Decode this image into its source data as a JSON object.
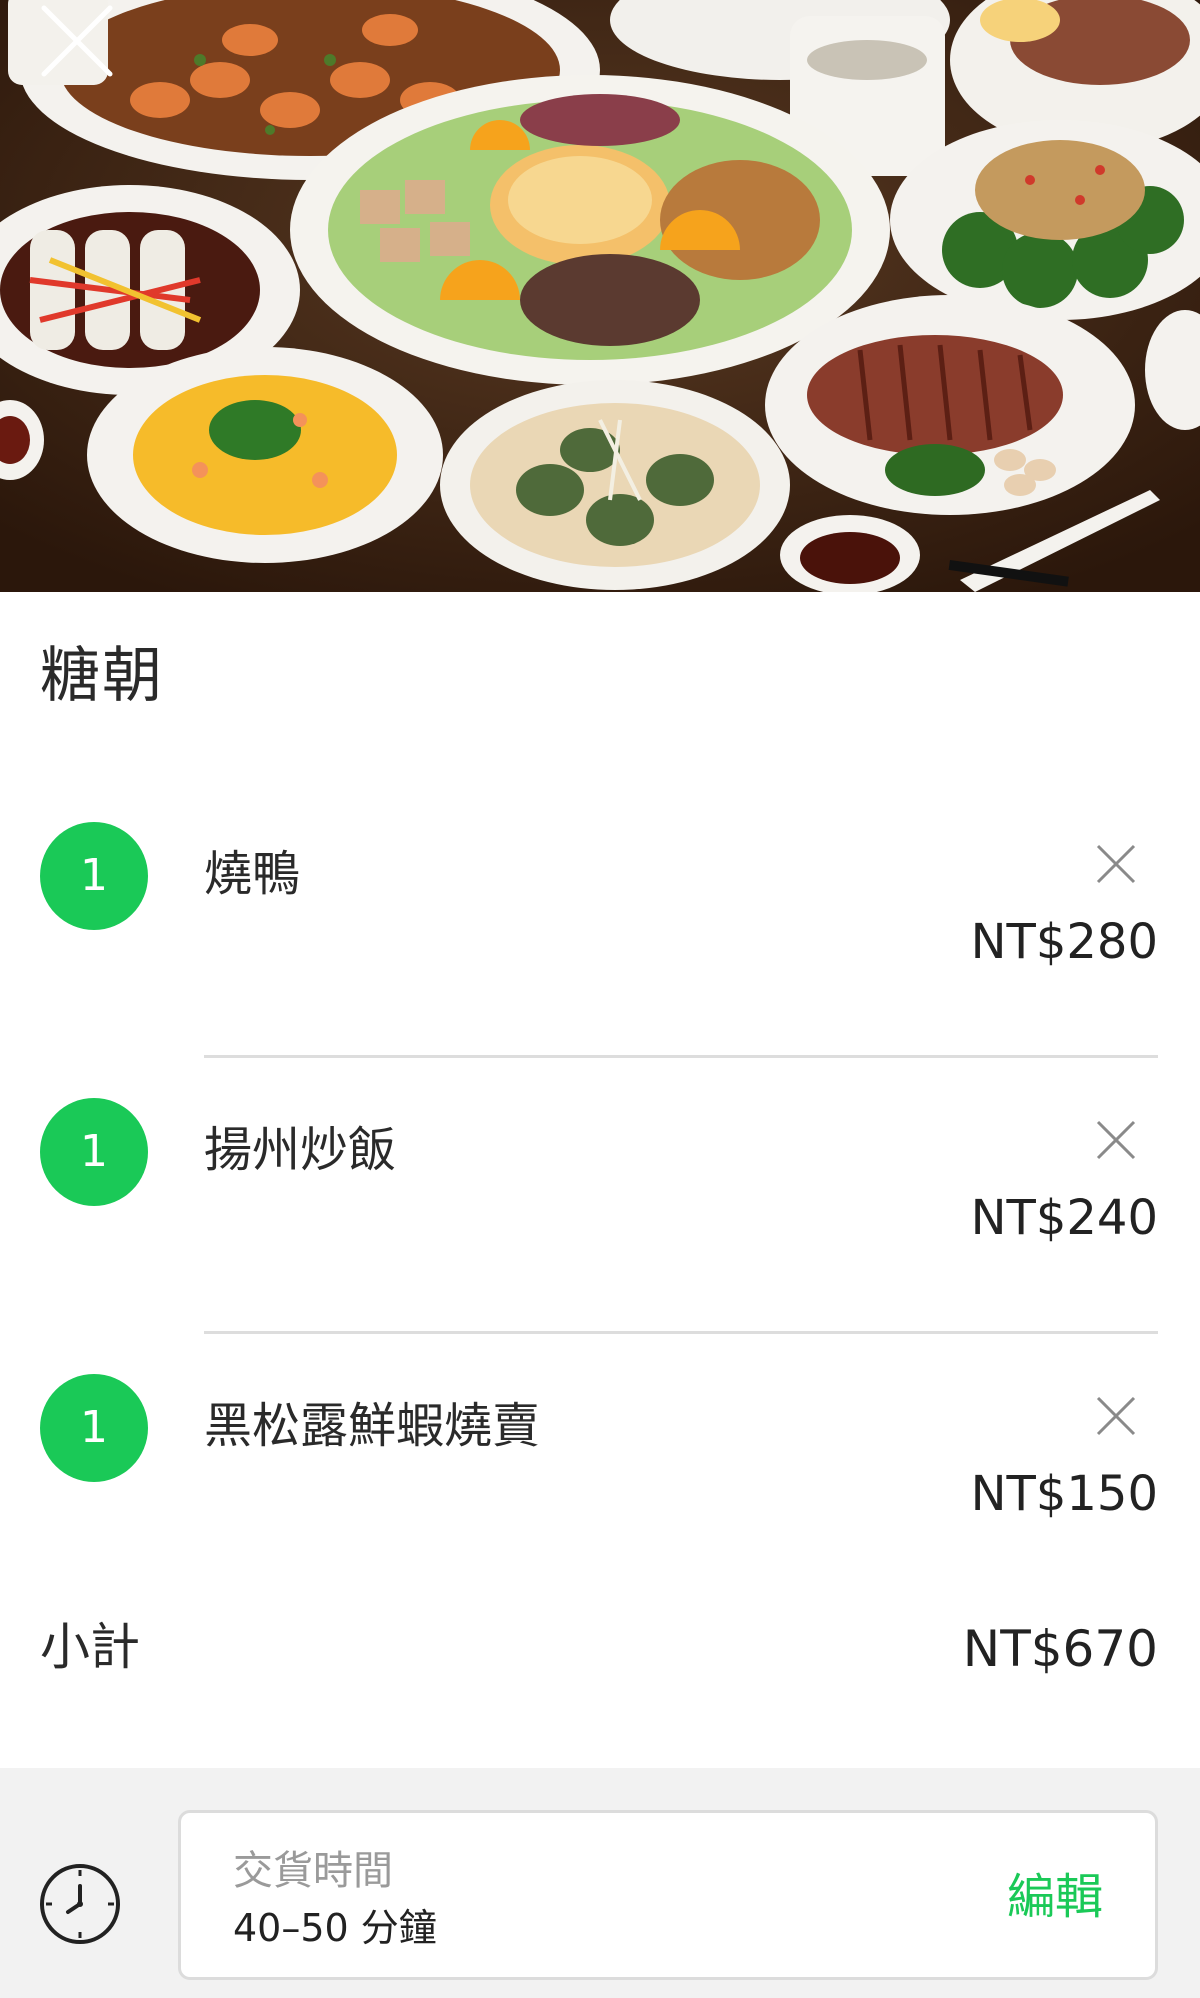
{
  "hero": {
    "image_description": "photo-of-chinese-banquet-dishes"
  },
  "store": {
    "name": "糖朝"
  },
  "cart": {
    "items": [
      {
        "qty": "1",
        "name": "燒鴨",
        "price": "NT$280"
      },
      {
        "qty": "1",
        "name": "揚州炒飯",
        "price": "NT$240"
      },
      {
        "qty": "1",
        "name": "黑松露鮮蝦燒賣",
        "price": "NT$150"
      }
    ],
    "subtotal_label": "小計",
    "subtotal_value": "NT$670"
  },
  "delivery": {
    "label": "交貨時間",
    "value": "40–50 分鐘",
    "edit_label": "編輯"
  },
  "colors": {
    "accent_green": "#1ac957",
    "divider": "#dddddd",
    "footer_bg": "#f2f2f2"
  },
  "icons": {
    "close": "close-icon",
    "remove": "remove-item-icon",
    "clock": "clock-icon"
  }
}
